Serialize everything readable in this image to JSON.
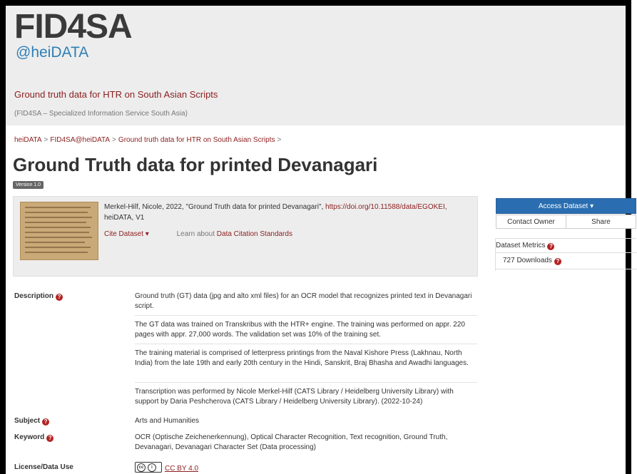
{
  "header": {
    "logo_prefix": "FID",
    "logo_four": "4",
    "logo_suffix": "SA",
    "logo_sub": "@heiDATA",
    "dataverse_title": "Ground truth data for HTR on South Asian Scripts",
    "dataverse_subtitle": "(FID4SA – Specialized Information Service South Asia)"
  },
  "breadcrumb": [
    {
      "label": "heiDATA"
    },
    {
      "label": "FID4SA@heiDATA"
    },
    {
      "label": "Ground truth data for HTR on South Asian Scripts"
    }
  ],
  "breadcrumb_separator": ">",
  "page_title": "Ground Truth data for printed Devanagari",
  "version_badge": "Version 1.0",
  "citation": {
    "text_before": "Merkel-Hilf, Nicole, 2022, \"Ground Truth data for printed Devanagari\", ",
    "doi_link": "https://doi.org/10.11588/data/EGOKEI",
    "text_after": ", heiDATA, V1",
    "cite_button": "Cite Dataset ▾",
    "learn_text": "Learn about ",
    "learn_link": "Data Citation Standards"
  },
  "actions": {
    "access_dataset": "Access Dataset ▾",
    "contact_owner": "Contact Owner",
    "share": "Share"
  },
  "metrics": {
    "title": "Dataset Metrics",
    "downloads": "727 Downloads"
  },
  "metadata": {
    "description_label": "Description",
    "description_paragraphs": [
      "Ground truth (GT) data (jpg and alto xml files) for an OCR model that recognizes printed text in Devanagari script.",
      "The GT data was trained on Transkribus with the HTR+ engine. The training was performed on appr. 220 pages with appr. 27,000 words. The validation set was 10% of the training set.",
      "The training material is comprised of letterpress printings from the Naval Kishore Press (Lakhnau, North India) from the late 19th and early 20th century in the Hindi, Sanskrit, Braj Bhasha and Awadhi languages.",
      "Transcription was performed by Nicole Merkel-Hilf (CATS Library / Heidelberg University Library) with support by Daria Peshcherova (CATS Library / Heidelberg University Library). (2022-10-24)"
    ],
    "subject_label": "Subject",
    "subject_value": "Arts and Humanities",
    "keyword_label": "Keyword",
    "keyword_value": "OCR (Optische Zeichenerkennung), Optical Character Recognition, Text recognition, Ground Truth, Devanagari, Devanagari Character Set (Data processing)",
    "license_label": "License/Data Use",
    "license_value": "CC BY 4.0"
  },
  "icons": {
    "help": "help-circle-icon",
    "cc": "creative-commons-icon"
  },
  "colors": {
    "link": "#8b1e1e",
    "logo_sub": "#2f7fb5",
    "primary_button": "#2a6eb1",
    "help_icon": "#b22222"
  }
}
